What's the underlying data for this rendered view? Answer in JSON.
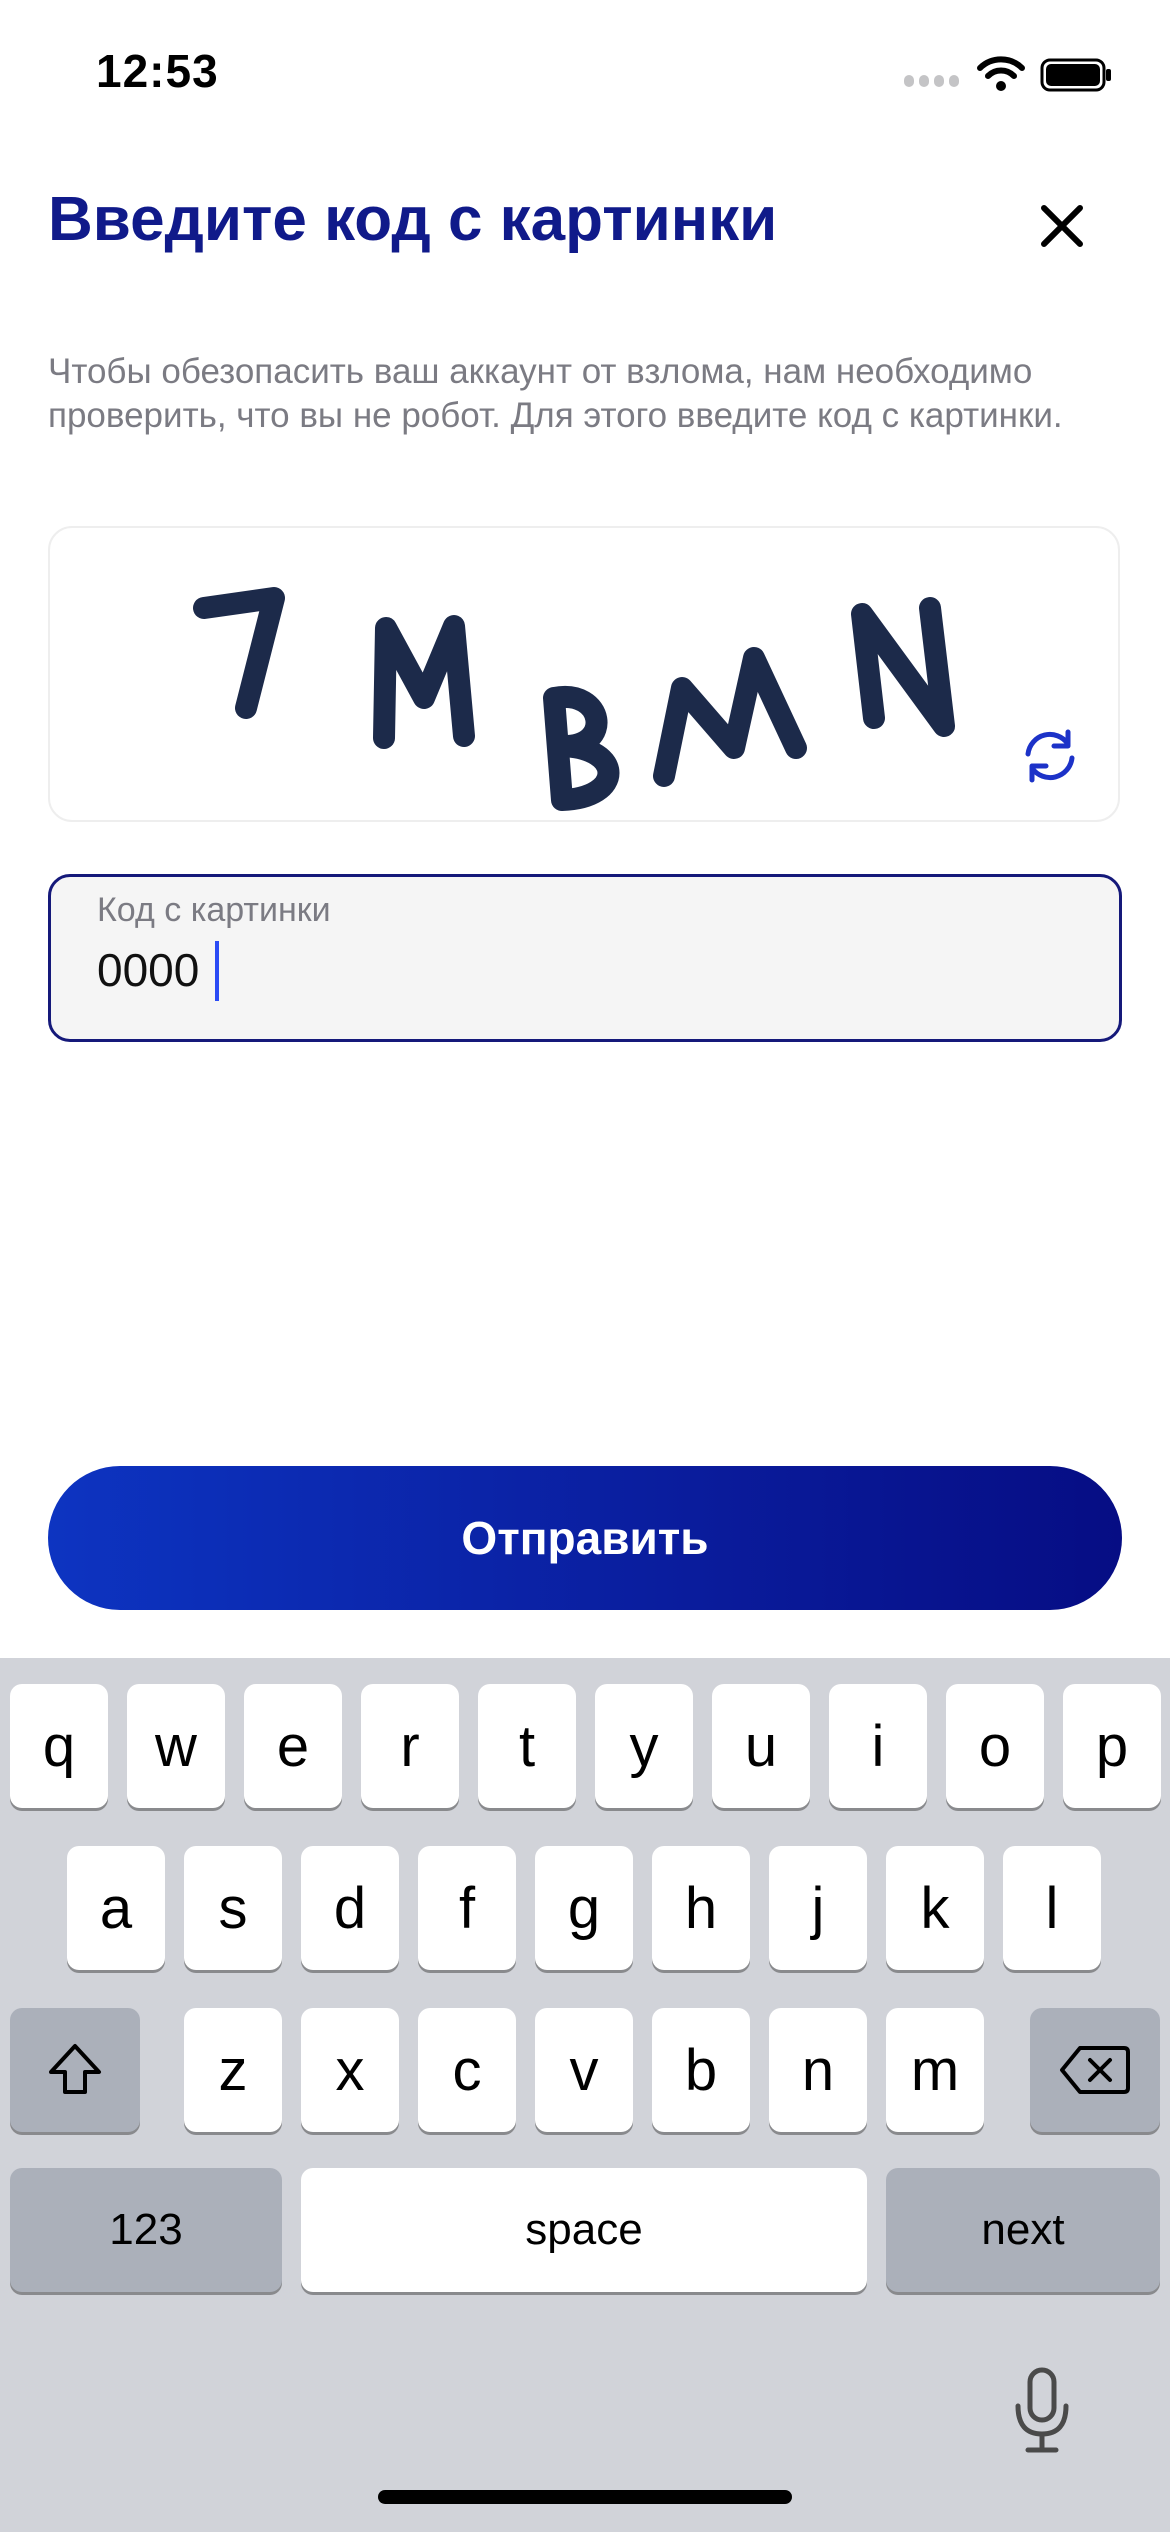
{
  "status_bar": {
    "time": "12:53"
  },
  "header": {
    "title": "Введите код с картинки",
    "description": "Чтобы обезопасить ваш аккаунт от взлома, нам необходимо проверить, что вы не робот. Для этого введите код с картинки."
  },
  "captcha": {
    "text": "7MBMN"
  },
  "code_field": {
    "label": "Код с картинки",
    "value": "0000"
  },
  "submit_label": "Отправить",
  "keyboard": {
    "row1": [
      "q",
      "w",
      "e",
      "r",
      "t",
      "y",
      "u",
      "i",
      "o",
      "p"
    ],
    "row2": [
      "a",
      "s",
      "d",
      "f",
      "g",
      "h",
      "j",
      "k",
      "l"
    ],
    "row3": [
      "z",
      "x",
      "c",
      "v",
      "b",
      "n",
      "m"
    ],
    "numbers_label": "123",
    "space_label": "space",
    "next_label": "next"
  },
  "colors": {
    "accent": "#101a8a",
    "button_start": "#0d34c1",
    "button_end": "#060d84",
    "caret": "#2a4bf5"
  }
}
